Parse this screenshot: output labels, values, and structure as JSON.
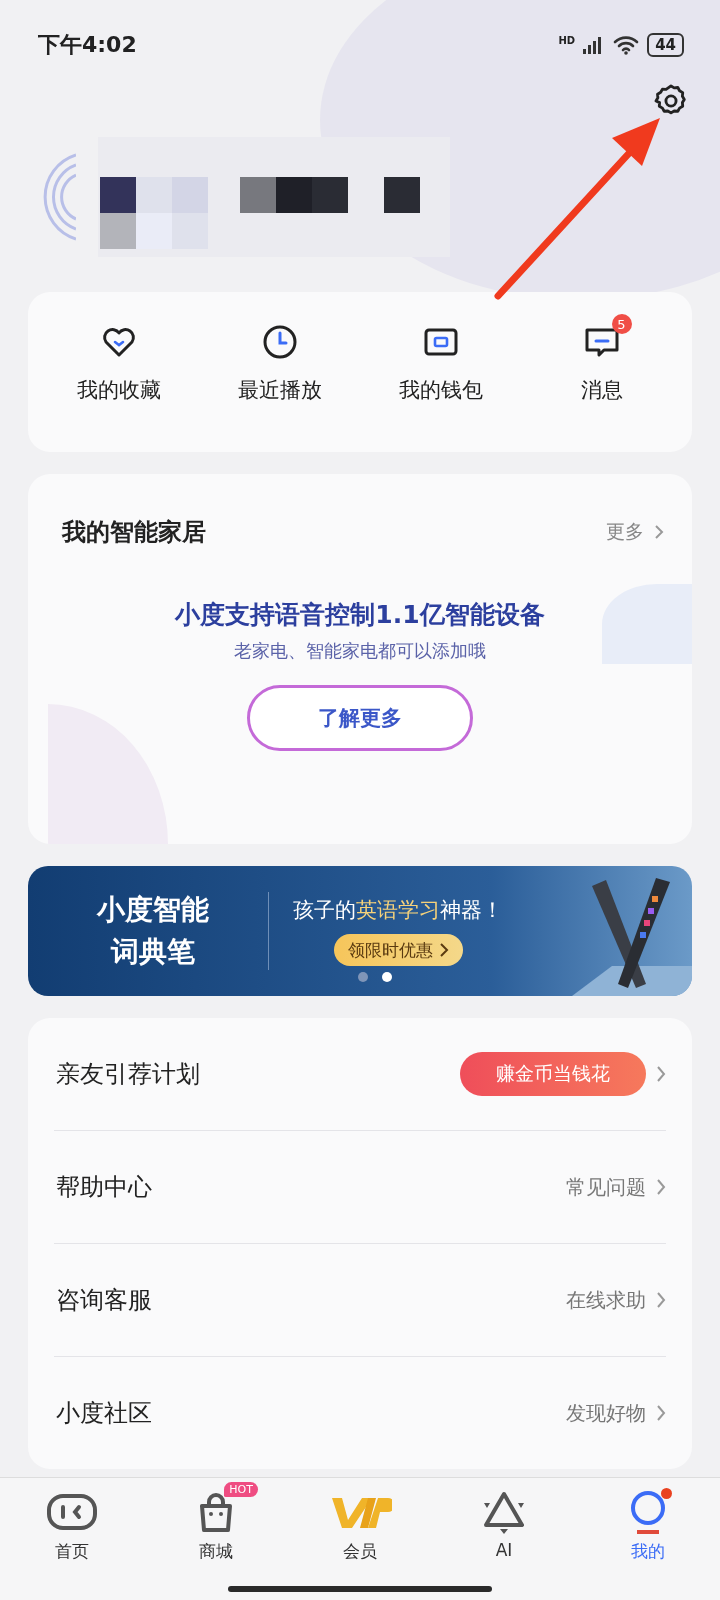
{
  "status_bar": {
    "time": "下午4:02",
    "network": "HD",
    "battery": "44"
  },
  "quick_actions": [
    {
      "label": "我的收藏",
      "kind": "heart"
    },
    {
      "label": "最近播放",
      "kind": "clock"
    },
    {
      "label": "我的钱包",
      "kind": "wallet"
    },
    {
      "label": "消息",
      "kind": "message",
      "badge": "5"
    }
  ],
  "smart_home": {
    "title": "我的智能家居",
    "more": "更多",
    "headline": "小度支持语音控制1.1亿智能设备",
    "subline": "老家电、智能家电都可以添加哦",
    "button": "了解更多"
  },
  "banner": {
    "title_lines": [
      "小度智能",
      "词典笔"
    ],
    "headline_parts": [
      "孩子的",
      "英语学习",
      "神器！"
    ],
    "button": "领限时优惠",
    "dots": [
      {
        "selected": false
      },
      {
        "selected": true
      }
    ]
  },
  "menu": [
    {
      "label": "亲友引荐计划",
      "kind": "pill",
      "action": "赚金币当钱花"
    },
    {
      "label": "帮助中心",
      "kind": "text",
      "action": "常见问题"
    },
    {
      "label": "咨询客服",
      "kind": "text",
      "action": "在线求助"
    },
    {
      "label": "小度社区",
      "kind": "text",
      "action": "发现好物"
    }
  ],
  "bottom_nav": [
    {
      "label": "首页",
      "kind": "home",
      "selected": false
    },
    {
      "label": "商城",
      "kind": "shop",
      "selected": false,
      "badge": "HOT"
    },
    {
      "label": "会员",
      "kind": "vip",
      "selected": false
    },
    {
      "label": "AI",
      "kind": "ai",
      "selected": false
    },
    {
      "label": "我的",
      "kind": "me",
      "selected": true,
      "dot": true
    }
  ]
}
